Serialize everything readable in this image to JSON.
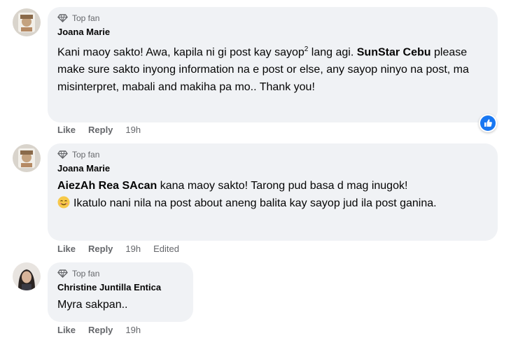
{
  "comments": [
    {
      "badge": "Top fan",
      "author": "Joana Marie",
      "text_part1": "Kani maoy sakto! Awa, kapila ni gi post kay sayop",
      "text_sup": "2",
      "text_part2": " lang agi. ",
      "mention": "SunStar Cebu",
      "text_part3": " please make sure sakto inyong information na e post or else, any sayop ninyo na post, ma misinterpret, mabali and makiha pa mo.. Thank you!",
      "like": "Like",
      "reply": "Reply",
      "time": "19h",
      "reaction": "like-reaction"
    },
    {
      "badge": "Top fan",
      "author": "Joana Marie",
      "mention": "AiezAh Rea SAcan",
      "text_part1": " kana maoy sakto! Tarong pud basa d mag inugok!",
      "text_part2": "Ikatulo nani nila na post about aneng balita kay sayop jud ila post ganina.",
      "like": "Like",
      "reply": "Reply",
      "time": "19h",
      "edited": "Edited"
    },
    {
      "badge": "Top fan",
      "author": "Christine Juntilla Entica",
      "text": "Myra sakpan..",
      "like": "Like",
      "reply": "Reply",
      "time": "19h"
    }
  ],
  "colors": {
    "bubble": "#f0f2f5",
    "meta": "#65676b",
    "text": "#050505",
    "like_blue": "#1877f2"
  },
  "icons": {
    "badge": "diamond-icon",
    "reaction": "thumbs-up-icon",
    "emoji": "smiling-face-icon"
  }
}
